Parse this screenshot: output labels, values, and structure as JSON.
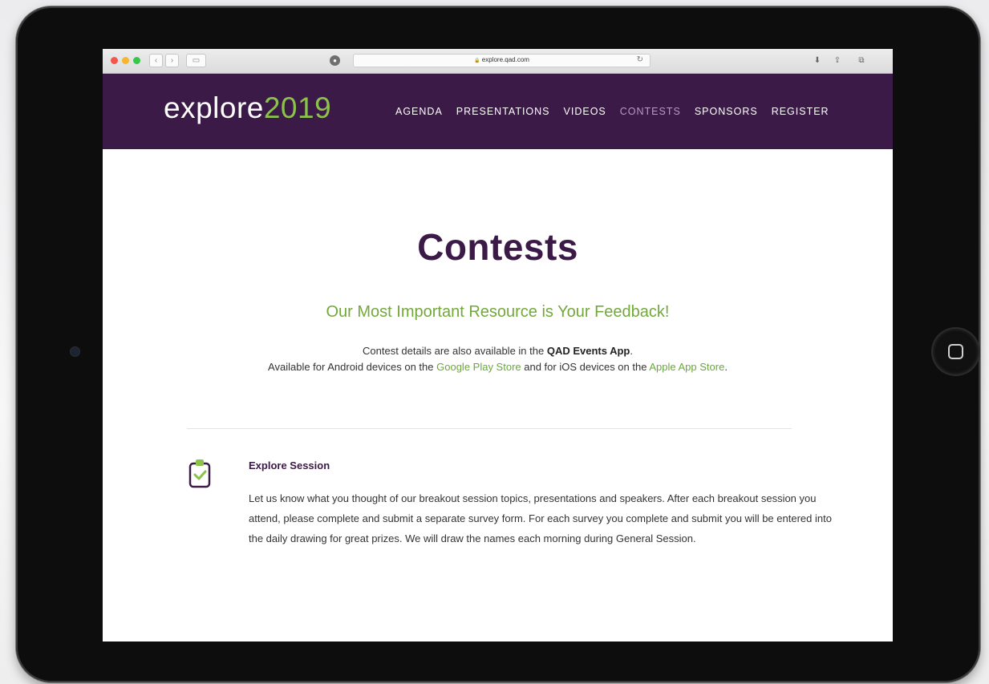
{
  "browser": {
    "url": "explore.qad.com",
    "lock_glyph": "🔒"
  },
  "header": {
    "logo_word": "explore",
    "logo_year": "2019",
    "nav": [
      {
        "label": "AGENDA",
        "active": false
      },
      {
        "label": "PRESENTATIONS",
        "active": false
      },
      {
        "label": "VIDEOS",
        "active": false
      },
      {
        "label": "CONTESTS",
        "active": true
      },
      {
        "label": "SPONSORS",
        "active": false
      },
      {
        "label": "REGISTER",
        "active": false
      }
    ]
  },
  "main": {
    "title": "Contests",
    "subtitle": "Our Most Important Resource is Your Feedback!",
    "intro_line1_prefix": "Contest details are also available in the ",
    "intro_line1_bold": "QAD Events App",
    "intro_line1_suffix": ".",
    "intro_line2_prefix": "Available for Android devices on the ",
    "google_link": "Google Play Store",
    "intro_line2_mid": " and for iOS devices on the ",
    "apple_link": "Apple App Store",
    "intro_line2_suffix": "."
  },
  "section": {
    "icon": "clipboard-check-icon",
    "title": "Explore Session",
    "body": "Let us know what you thought of our breakout session topics, presentations and speakers. After each breakout session you attend, please complete and submit a separate survey form. For each survey you complete and submit you will be entered into the daily drawing for great prizes. We will draw the names each morning during General Session."
  },
  "colors": {
    "brand_purple": "#3c1a47",
    "brand_green": "#8bc34a",
    "link_green": "#6aa83a"
  }
}
